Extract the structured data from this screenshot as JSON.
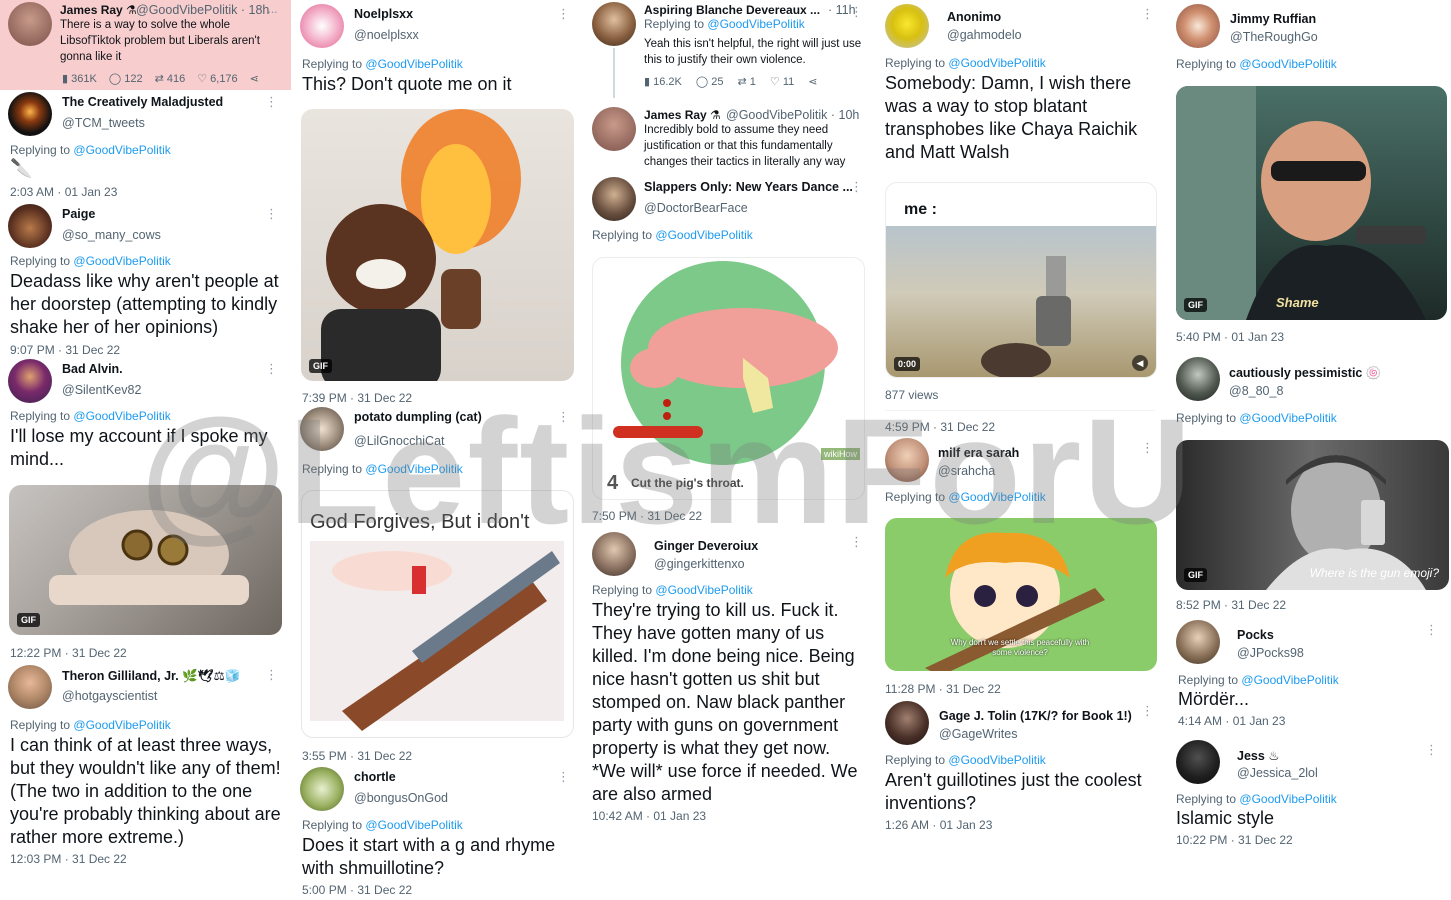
{
  "watermark": "@LeftismForU",
  "c1": {
    "t1": {
      "name": "James Ray ⚗",
      "handle": "@GoodVibePolitik · 18h",
      "text": "There is a way to solve the whole LibsofTiktok problem but Liberals aren't gonna like it",
      "views": "361K",
      "replies": "122",
      "retweets": "416",
      "likes": "6,176"
    },
    "t2": {
      "name": "The Creatively Maladjusted",
      "handle": "@TCM_tweets",
      "replying": "Replying to",
      "at": "@GoodVibePolitik",
      "text": "🔪",
      "time": "2:03 AM · 01 Jan 23"
    },
    "t3": {
      "name": "Paige",
      "handle": "@so_many_cows",
      "replying": "Replying to",
      "at": "@GoodVibePolitik",
      "text": "Deadass like why aren't people at her doorstep (attempting to kindly shake her of her opinions)",
      "time": "9:07 PM · 31 Dec 22"
    },
    "t4": {
      "name": "Bad Alvin.",
      "handle": "@SilentKev82",
      "replying": "Replying to",
      "at": "@GoodVibePolitik",
      "text": "I'll lose my account if I spoke my mind...",
      "gif": "GIF",
      "time": "12:22 PM · 31 Dec 22"
    },
    "t5": {
      "name": "Theron Gilliland, Jr. 🌿🕊⚖🧊",
      "handle": "@hotgayscientist",
      "replying": "Replying to",
      "at": "@GoodVibePolitik",
      "text": "I can think of at least three ways, but they wouldn't like any of them! (The two in addition to the one you're probably thinking about are rather more extreme.)",
      "time": "12:03 PM · 31 Dec 22"
    }
  },
  "c2": {
    "t1": {
      "name": "Noelplsxx",
      "handle": "@noelplsxx",
      "replying": "Replying to",
      "at": "@GoodVibePolitik",
      "text": "This? Don't quote me on it",
      "gif": "GIF",
      "time": "7:39 PM · 31 Dec 22"
    },
    "t2": {
      "name": "potato dumpling (cat)",
      "handle": "@LilGnocchiCat",
      "replying": "Replying to",
      "at": "@GoodVibePolitik",
      "meme": "God Forgives, But i don't",
      "time": "3:55 PM · 31 Dec 22"
    },
    "t3": {
      "name": "chortle",
      "handle": "@bongusOnGod",
      "replying": "Replying to",
      "at": "@GoodVibePolitik",
      "text": "Does it start with a g and rhyme with shmuillotine?",
      "time": "5:00 PM · 31 Dec 22"
    }
  },
  "c3": {
    "t1": {
      "name": "Aspiring Blanche Devereaux ...",
      "handle": "· 11h",
      "replying": "Replying to",
      "at": "@GoodVibePolitik",
      "text": "Yeah this isn't helpful, the right will just use this to justify their own violence.",
      "views": "16.2K",
      "replies": "25",
      "retweets": "1",
      "likes": "11"
    },
    "t2": {
      "name": "James Ray ⚗",
      "handle": "@GoodVibePolitik · 10h",
      "text": "Incredibly bold to assume they need justification or that this fundamentally changes their tactics in literally any way"
    },
    "t3": {
      "name": "Slappers Only: New Years Dance ...",
      "handle": "@DoctorBearFace",
      "replying": "Replying to",
      "at": "@GoodVibePolitik",
      "step": "4",
      "caption": "Cut the pig's throat.",
      "brand": "wikiHow",
      "time": "7:50 PM · 31 Dec 22"
    },
    "t4": {
      "name": "Ginger Deveroiux",
      "handle": "@gingerkittenxo",
      "replying": "Replying to",
      "at": "@GoodVibePolitik",
      "text": "They're trying to kill us. Fuck it. They have gotten many of us killed. I'm done being nice. Being nice hasn't gotten us shit but stomped on. Naw black panther party with guns on government property is what they get now. *We will* use force if needed. We are also armed",
      "time": "10:42 AM · 01 Jan 23"
    }
  },
  "c4": {
    "t1": {
      "name": "Anonimo",
      "handle": "@gahmodelo",
      "replying": "Replying to",
      "at": "@GoodVibePolitik",
      "text": "Somebody: Damn, I wish there was a way to stop blatant transphobes like Chaya Raichik and Matt Walsh",
      "me": "me :",
      "vtime": "0:00",
      "views": "877 views",
      "time": "4:59 PM · 31 Dec 22"
    },
    "t2": {
      "name": "milf era sarah",
      "handle": "@srahcha",
      "replying": "Replying to",
      "at": "@GoodVibePolitik",
      "caption": "Why don't we settle this peacefully with some violence?",
      "time": "11:28 PM · 31 Dec 22"
    },
    "t3": {
      "name": "Gage J. Tolin (17K/? for Book 1!)",
      "handle": "@GageWrites",
      "replying": "Replying to",
      "at": "@GoodVibePolitik",
      "text": "Aren't guillotines just the coolest inventions?",
      "time": "1:26 AM · 01 Jan 23"
    }
  },
  "c5": {
    "t1": {
      "name": "Jimmy Ruffian",
      "handle": "@TheRoughGo",
      "replying": "Replying to",
      "at": "@GoodVibePolitik",
      "caption": "Shame",
      "gif": "GIF",
      "time": "5:40 PM · 01 Jan 23"
    },
    "t2": {
      "name": "cautiously pessimistic 🍥",
      "handle": "@8_80_8",
      "replying": "Replying to",
      "at": "@GoodVibePolitik",
      "caption": "Where is the gun emoji?",
      "gif": "GIF",
      "time": "8:52 PM · 31 Dec 22"
    },
    "t3": {
      "name": "Pocks",
      "handle": "@JPocks98",
      "replying": "Replying to",
      "at": "@GoodVibePolitik",
      "text": "Mördër...",
      "time": "4:14 AM · 01 Jan 23"
    },
    "t4": {
      "name": "Jess ♨",
      "handle": "@Jessica_2lol",
      "replying": "Replying to",
      "at": "@GoodVibePolitik",
      "text": "Islamic style",
      "time": "10:22 PM · 31 Dec 22"
    }
  },
  "icons": {
    "views": "bar-chart-icon",
    "reply": "reply-icon",
    "retweet": "retweet-icon",
    "like": "heart-icon",
    "share": "share-icon",
    "more": "more-dots-icon"
  },
  "colors": {
    "link": "#1d9bf0",
    "secondary": "#536471",
    "highlight": "#fbd0d0"
  }
}
